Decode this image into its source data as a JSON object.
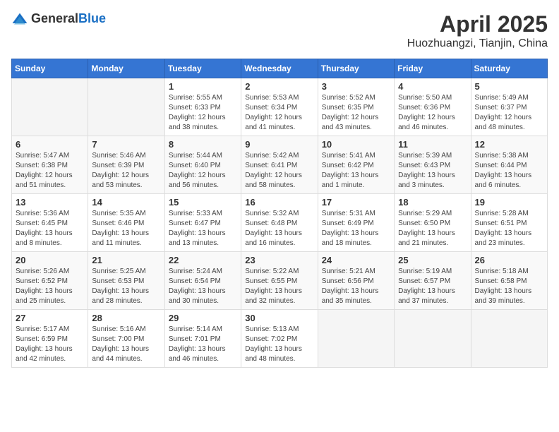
{
  "header": {
    "logo_general": "General",
    "logo_blue": "Blue",
    "title": "April 2025",
    "location": "Huozhuangzi, Tianjin, China"
  },
  "weekdays": [
    "Sunday",
    "Monday",
    "Tuesday",
    "Wednesday",
    "Thursday",
    "Friday",
    "Saturday"
  ],
  "weeks": [
    [
      {
        "day": "",
        "sunrise": "",
        "sunset": "",
        "daylight": ""
      },
      {
        "day": "",
        "sunrise": "",
        "sunset": "",
        "daylight": ""
      },
      {
        "day": "1",
        "sunrise": "Sunrise: 5:55 AM",
        "sunset": "Sunset: 6:33 PM",
        "daylight": "Daylight: 12 hours and 38 minutes."
      },
      {
        "day": "2",
        "sunrise": "Sunrise: 5:53 AM",
        "sunset": "Sunset: 6:34 PM",
        "daylight": "Daylight: 12 hours and 41 minutes."
      },
      {
        "day": "3",
        "sunrise": "Sunrise: 5:52 AM",
        "sunset": "Sunset: 6:35 PM",
        "daylight": "Daylight: 12 hours and 43 minutes."
      },
      {
        "day": "4",
        "sunrise": "Sunrise: 5:50 AM",
        "sunset": "Sunset: 6:36 PM",
        "daylight": "Daylight: 12 hours and 46 minutes."
      },
      {
        "day": "5",
        "sunrise": "Sunrise: 5:49 AM",
        "sunset": "Sunset: 6:37 PM",
        "daylight": "Daylight: 12 hours and 48 minutes."
      }
    ],
    [
      {
        "day": "6",
        "sunrise": "Sunrise: 5:47 AM",
        "sunset": "Sunset: 6:38 PM",
        "daylight": "Daylight: 12 hours and 51 minutes."
      },
      {
        "day": "7",
        "sunrise": "Sunrise: 5:46 AM",
        "sunset": "Sunset: 6:39 PM",
        "daylight": "Daylight: 12 hours and 53 minutes."
      },
      {
        "day": "8",
        "sunrise": "Sunrise: 5:44 AM",
        "sunset": "Sunset: 6:40 PM",
        "daylight": "Daylight: 12 hours and 56 minutes."
      },
      {
        "day": "9",
        "sunrise": "Sunrise: 5:42 AM",
        "sunset": "Sunset: 6:41 PM",
        "daylight": "Daylight: 12 hours and 58 minutes."
      },
      {
        "day": "10",
        "sunrise": "Sunrise: 5:41 AM",
        "sunset": "Sunset: 6:42 PM",
        "daylight": "Daylight: 13 hours and 1 minute."
      },
      {
        "day": "11",
        "sunrise": "Sunrise: 5:39 AM",
        "sunset": "Sunset: 6:43 PM",
        "daylight": "Daylight: 13 hours and 3 minutes."
      },
      {
        "day": "12",
        "sunrise": "Sunrise: 5:38 AM",
        "sunset": "Sunset: 6:44 PM",
        "daylight": "Daylight: 13 hours and 6 minutes."
      }
    ],
    [
      {
        "day": "13",
        "sunrise": "Sunrise: 5:36 AM",
        "sunset": "Sunset: 6:45 PM",
        "daylight": "Daylight: 13 hours and 8 minutes."
      },
      {
        "day": "14",
        "sunrise": "Sunrise: 5:35 AM",
        "sunset": "Sunset: 6:46 PM",
        "daylight": "Daylight: 13 hours and 11 minutes."
      },
      {
        "day": "15",
        "sunrise": "Sunrise: 5:33 AM",
        "sunset": "Sunset: 6:47 PM",
        "daylight": "Daylight: 13 hours and 13 minutes."
      },
      {
        "day": "16",
        "sunrise": "Sunrise: 5:32 AM",
        "sunset": "Sunset: 6:48 PM",
        "daylight": "Daylight: 13 hours and 16 minutes."
      },
      {
        "day": "17",
        "sunrise": "Sunrise: 5:31 AM",
        "sunset": "Sunset: 6:49 PM",
        "daylight": "Daylight: 13 hours and 18 minutes."
      },
      {
        "day": "18",
        "sunrise": "Sunrise: 5:29 AM",
        "sunset": "Sunset: 6:50 PM",
        "daylight": "Daylight: 13 hours and 21 minutes."
      },
      {
        "day": "19",
        "sunrise": "Sunrise: 5:28 AM",
        "sunset": "Sunset: 6:51 PM",
        "daylight": "Daylight: 13 hours and 23 minutes."
      }
    ],
    [
      {
        "day": "20",
        "sunrise": "Sunrise: 5:26 AM",
        "sunset": "Sunset: 6:52 PM",
        "daylight": "Daylight: 13 hours and 25 minutes."
      },
      {
        "day": "21",
        "sunrise": "Sunrise: 5:25 AM",
        "sunset": "Sunset: 6:53 PM",
        "daylight": "Daylight: 13 hours and 28 minutes."
      },
      {
        "day": "22",
        "sunrise": "Sunrise: 5:24 AM",
        "sunset": "Sunset: 6:54 PM",
        "daylight": "Daylight: 13 hours and 30 minutes."
      },
      {
        "day": "23",
        "sunrise": "Sunrise: 5:22 AM",
        "sunset": "Sunset: 6:55 PM",
        "daylight": "Daylight: 13 hours and 32 minutes."
      },
      {
        "day": "24",
        "sunrise": "Sunrise: 5:21 AM",
        "sunset": "Sunset: 6:56 PM",
        "daylight": "Daylight: 13 hours and 35 minutes."
      },
      {
        "day": "25",
        "sunrise": "Sunrise: 5:19 AM",
        "sunset": "Sunset: 6:57 PM",
        "daylight": "Daylight: 13 hours and 37 minutes."
      },
      {
        "day": "26",
        "sunrise": "Sunrise: 5:18 AM",
        "sunset": "Sunset: 6:58 PM",
        "daylight": "Daylight: 13 hours and 39 minutes."
      }
    ],
    [
      {
        "day": "27",
        "sunrise": "Sunrise: 5:17 AM",
        "sunset": "Sunset: 6:59 PM",
        "daylight": "Daylight: 13 hours and 42 minutes."
      },
      {
        "day": "28",
        "sunrise": "Sunrise: 5:16 AM",
        "sunset": "Sunset: 7:00 PM",
        "daylight": "Daylight: 13 hours and 44 minutes."
      },
      {
        "day": "29",
        "sunrise": "Sunrise: 5:14 AM",
        "sunset": "Sunset: 7:01 PM",
        "daylight": "Daylight: 13 hours and 46 minutes."
      },
      {
        "day": "30",
        "sunrise": "Sunrise: 5:13 AM",
        "sunset": "Sunset: 7:02 PM",
        "daylight": "Daylight: 13 hours and 48 minutes."
      },
      {
        "day": "",
        "sunrise": "",
        "sunset": "",
        "daylight": ""
      },
      {
        "day": "",
        "sunrise": "",
        "sunset": "",
        "daylight": ""
      },
      {
        "day": "",
        "sunrise": "",
        "sunset": "",
        "daylight": ""
      }
    ]
  ]
}
